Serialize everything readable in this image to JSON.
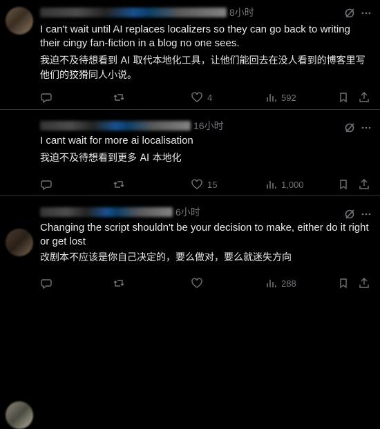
{
  "posts": [
    {
      "time": "8小时",
      "text": "I can't wait until AI replaces localizers so they can go back to writing their cingy fan-fiction in a blog no one sees.",
      "translation": "我迫不及待想看到 AI 取代本地化工具，让他们能回去在没人看到的博客里写他们的狡猾同人小说。",
      "likes": "4",
      "views": "592"
    },
    {
      "time": "16小时",
      "text": "I cant wait for more ai localisation",
      "translation": "我迫不及待想看到更多 AI 本地化",
      "likes": "15",
      "views": "1,000"
    },
    {
      "time": "6小时",
      "text": "Changing the script shouldn't be your decision to make, either do it right or get lost",
      "translation": "改剧本不应该是你自己决定的，要么做对，要么就迷失方向",
      "likes": "",
      "views": "288"
    }
  ],
  "icons": {
    "reply": "reply-icon",
    "retweet": "retweet-icon",
    "like": "heart-icon",
    "views": "views-icon",
    "bookmark": "bookmark-icon",
    "share": "share-icon",
    "grok": "grok-icon",
    "more": "more-icon"
  },
  "colors": {
    "background": "#000000",
    "text": "#e7e9ea",
    "muted": "#71767b",
    "divider": "#2f3336"
  }
}
